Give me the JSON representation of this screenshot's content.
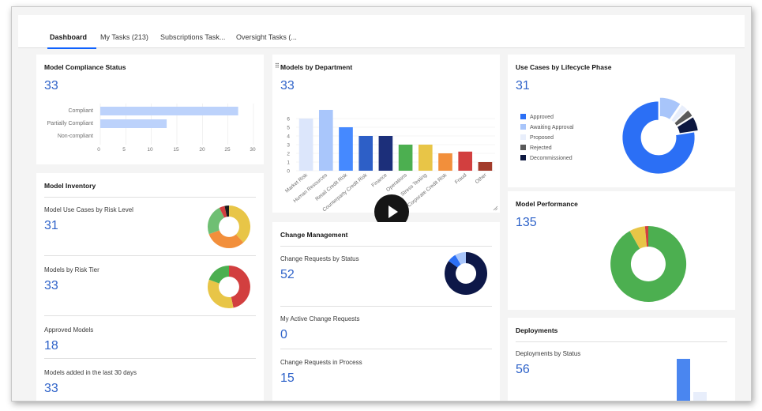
{
  "tabs": [
    {
      "label": "Dashboard",
      "active": true
    },
    {
      "label": "My Tasks (213)",
      "active": false
    },
    {
      "label": "Subscriptions Task...",
      "active": false
    },
    {
      "label": "Oversight Tasks (...",
      "active": false
    }
  ],
  "compliance": {
    "title": "Model Compliance Status",
    "count": "33",
    "categories": [
      "Compliant",
      "Partially Compliant",
      "Non-compliant"
    ],
    "values": [
      27,
      13,
      0
    ],
    "ticks": [
      "0",
      "5",
      "10",
      "15",
      "20",
      "25",
      "30"
    ],
    "bar_color": "#bcd2fb"
  },
  "inventory": {
    "title": "Model Inventory",
    "risk_level": {
      "label": "Model Use Cases by Risk Level",
      "count": "31"
    },
    "risk_tier": {
      "label": "Models by Risk Tier",
      "count": "33"
    },
    "approved": {
      "label": "Approved Models",
      "count": "18"
    },
    "added": {
      "label": "Models added in the last 30 days",
      "count": "33"
    }
  },
  "departments": {
    "title": "Models by Department",
    "drag_icon": "drag-handle-icon",
    "count": "33",
    "chart_data": {
      "type": "bar",
      "categories": [
        "Market Risk",
        "Human Resources",
        "Retail Credit Risk",
        "Counterparty Credit Risk",
        "Finance",
        "Operations",
        "Stress Testing",
        "Corporate Credit Risk",
        "Fraud",
        "Other"
      ],
      "values": [
        6,
        7,
        5,
        4,
        4,
        3,
        3,
        2,
        2.2,
        1
      ],
      "colors": [
        "#dce6fb",
        "#a9c6fb",
        "#4589ff",
        "#2d5fc7",
        "#1c2f7a",
        "#4caf50",
        "#e8c547",
        "#f28f3b",
        "#d23f3f",
        "#a33b2b"
      ],
      "ylim": [
        0,
        7
      ],
      "yticks": [
        "0",
        "1",
        "2",
        "3",
        "4",
        "5",
        "6"
      ]
    }
  },
  "lifecycle": {
    "title": "Use Cases by Lifecycle Phase",
    "count": "31",
    "legend": [
      {
        "label": "Approved",
        "color": "#2b6ff5",
        "value": 24
      },
      {
        "label": "Awaiting Approval",
        "color": "#a8c5fa",
        "value": 3
      },
      {
        "label": "Proposed",
        "color": "#e8eefb",
        "value": 1
      },
      {
        "label": "Rejected",
        "color": "#5a5a5a",
        "value": 1
      },
      {
        "label": "Decommissioned",
        "color": "#0d1840",
        "value": 2
      }
    ]
  },
  "change": {
    "title": "Change Management",
    "by_status": {
      "label": "Change Requests by Status",
      "count": "52"
    },
    "active": {
      "label": "My Active Change Requests",
      "count": "0"
    },
    "in_process": {
      "label": "Change Requests in Process",
      "count": "15"
    }
  },
  "performance": {
    "title": "Model Performance",
    "count": "135"
  },
  "deployments": {
    "title": "Deployments",
    "by_status": {
      "label": "Deployments by Status",
      "count": "56"
    }
  }
}
